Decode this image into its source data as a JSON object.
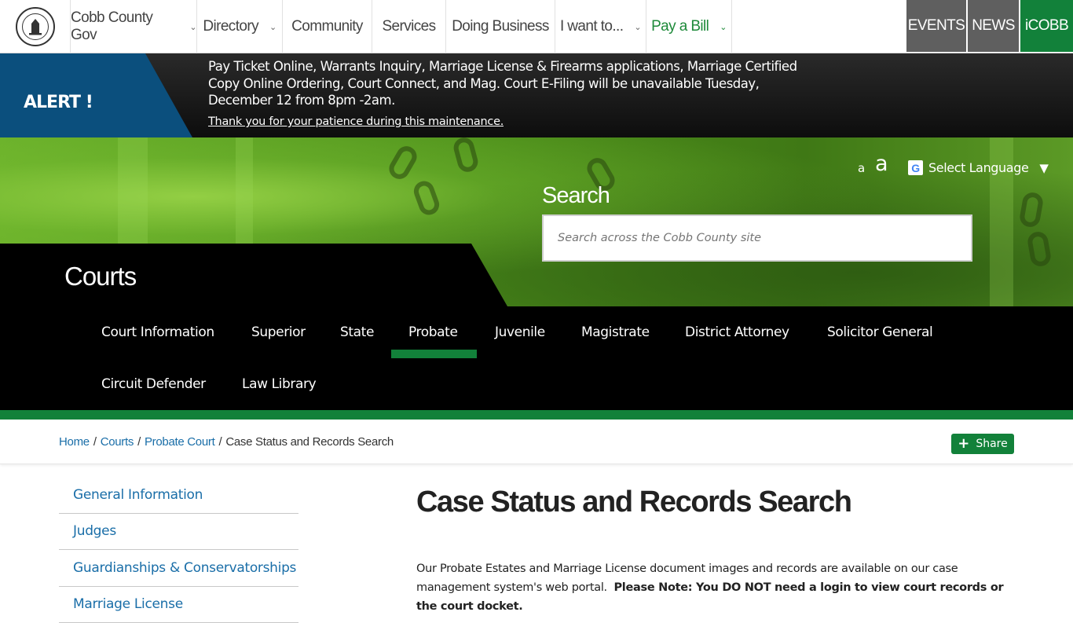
{
  "top_nav": {
    "logo_alt": "Cobb County Georgia seal",
    "items": [
      {
        "label": "Cobb County Gov",
        "has_dropdown": true
      },
      {
        "label": "Directory",
        "has_dropdown": true
      },
      {
        "label": "Community",
        "has_dropdown": false
      },
      {
        "label": "Services",
        "has_dropdown": false
      },
      {
        "label": "Doing Business",
        "has_dropdown": false
      },
      {
        "label": "I want to...",
        "has_dropdown": true
      },
      {
        "label": "Pay a Bill",
        "has_dropdown": true
      }
    ],
    "chevron": "⌄",
    "buttons": [
      {
        "label": "EVENTS",
        "color": "#5f5f5f"
      },
      {
        "label": "NEWS",
        "color": "#5f5f5f"
      },
      {
        "label": "iCOBB",
        "color": "#12813a"
      }
    ]
  },
  "alert": {
    "label": "ALERT !",
    "message": "Pay Ticket Online, Warrants Inquiry, Marriage License & Firearms applications, Marriage Certified Copy Online Ordering, Court Connect, and Mag. Court E-Filing will be unavailable Tuesday, December 12 from 8pm -2am.",
    "link": "Thank you for your patience during this maintenance."
  },
  "hero": {
    "font_small": "a",
    "font_large": "a",
    "google_icon": "G",
    "language_label": "Select Language",
    "language_caret": "▼",
    "search_label": "Search",
    "search_placeholder": "Search across the Cobb County site",
    "department_title": "Courts"
  },
  "section_nav": {
    "items": [
      "Court Information",
      "Superior",
      "State",
      "Probate",
      "Juvenile",
      "Magistrate",
      "District Attorney",
      "Solicitor General",
      "Circuit Defender",
      "Law Library"
    ],
    "active": "Probate"
  },
  "breadcrumb": {
    "items": [
      "Home",
      "Courts",
      "Probate Court"
    ],
    "current": "Case Status and Records Search",
    "separator": "/"
  },
  "share": {
    "icon": "+",
    "label": "Share"
  },
  "left_nav": {
    "items": [
      "General Information",
      "Judges",
      "Guardianships & Conservatorships",
      "Marriage License"
    ]
  },
  "content": {
    "title": "Case Status and Records Search",
    "para_text": "Our Probate Estates and Marriage License document images and records are available on our case management system's web portal.",
    "para_bold": "Please Note:  You DO NOT need a login to view court records or the court docket."
  },
  "colors": {
    "accent_green": "#12813a",
    "alert_blue": "#0b4f7d",
    "link_blue": "#1a6ea8"
  }
}
